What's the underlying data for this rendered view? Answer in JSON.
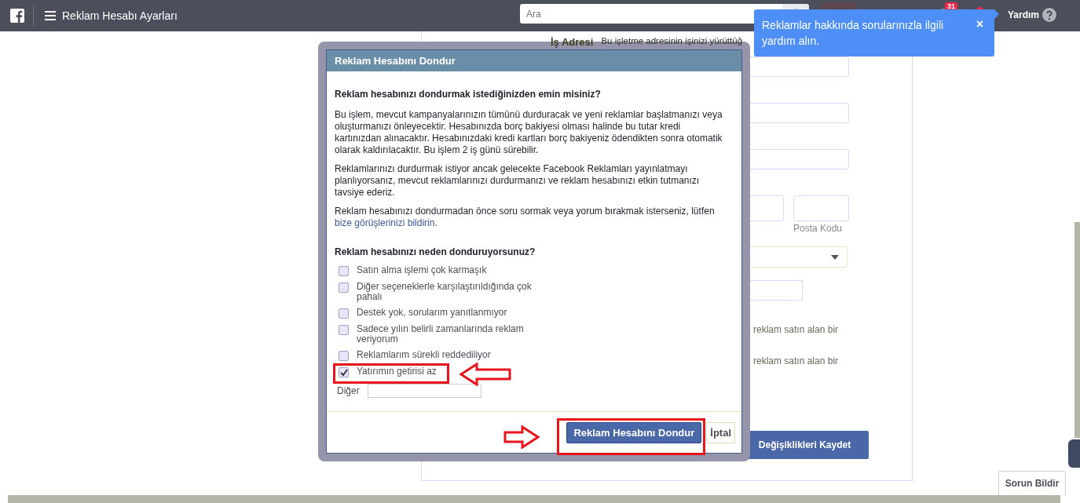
{
  "topbar": {
    "title": "Reklam Hesabı Ayarları",
    "search": {
      "placeholder": "Ara"
    },
    "notifications_badge": "31",
    "help": "Yardım"
  },
  "tooltip": {
    "text": "Reklamlar hakkında sorularınızla ilgili yardım alın.",
    "close": "×"
  },
  "settings_form": {
    "address_label": "İş Adresi",
    "address_hint": "Bu işletme adresinin işinizi yürüttüğ",
    "postal_code_label": "Posta Kodu",
    "option_texts": [
      "reklam satın alan bir",
      "reklam satın alan bir"
    ],
    "save_button": "Değişiklikleri Kaydet"
  },
  "dialog": {
    "title": "Reklam Hesabını Dondur",
    "question": "Reklam hesabınızı dondurmak istediğinizden emin misiniz?",
    "paragraphs": [
      "Bu işlem, mevcut kampanyalarınızın tümünü durduracak ve yeni reklamlar başlatmanızı veya oluşturmanızı önleyecektir. Hesabınızda borç bakiyesi olması halinde bu tutar kredi kartınızdan alınacaktır. Hesabınızdaki kredi kartları borç bakiyeniz ödendikten sonra otomatik olarak kaldırılacaktır. Bu işlem 2 iş günü sürebilir.",
      "Reklamlarınızı durdurmak istiyor ancak gelecekte Facebook Reklamları yayınlatmayı planlıyorsanız, mevcut reklamlarınızı durdurmanızı ve reklam hesabınızı etkin tutmanızı tavsiye ederiz.",
      "Reklam hesabınızı dondurmadan önce soru sormak veya yorum bırakmak isterseniz, lütfen"
    ],
    "feedback_link": "bize görüşlerinizi bildirin.",
    "reason_question": "Reklam hesabınızı neden donduruyorsunuz?",
    "reasons": [
      {
        "label": "Satın alma işlemi çok karmaşık",
        "checked": false
      },
      {
        "label": "Diğer seçeneklerle karşılaştırıldığında çok pahalı",
        "checked": false
      },
      {
        "label": "Destek yok, sorularım yanıtlanmıyor",
        "checked": false
      },
      {
        "label": "Sadece yılın belirli zamanlarında reklam veriyorum",
        "checked": false
      },
      {
        "label": "Reklamlarım sürekli reddediliyor",
        "checked": false
      },
      {
        "label": "Yatırımın getirisi az",
        "checked": true
      }
    ],
    "other_label": "Diğer",
    "primary_button": "Reklam Hesabını Dondur",
    "cancel_button": "İptal"
  },
  "report_button": "Sorun Bildir"
}
